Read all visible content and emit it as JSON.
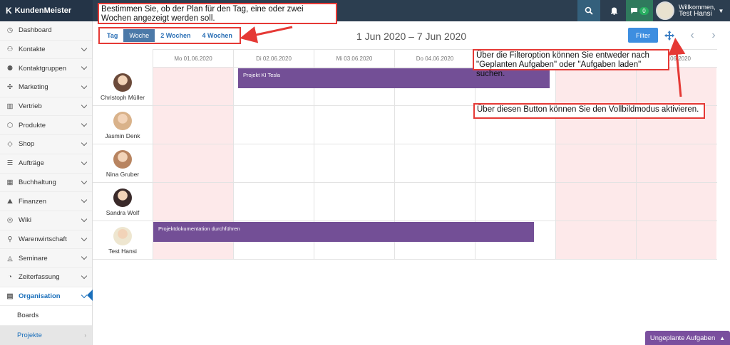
{
  "app": {
    "brand": "KundenMeister"
  },
  "topbar": {
    "chat_badge": "0",
    "welcome": "Willkommen,",
    "user_name": "Test Hansi"
  },
  "sidebar": {
    "items": [
      {
        "label": "Dashboard",
        "icon": "dashboard-icon"
      },
      {
        "label": "Kontakte",
        "icon": "contacts-icon"
      },
      {
        "label": "Kontaktgruppen",
        "icon": "groups-icon"
      },
      {
        "label": "Marketing",
        "icon": "marketing-icon"
      },
      {
        "label": "Vertrieb",
        "icon": "chart-icon"
      },
      {
        "label": "Produkte",
        "icon": "box-icon"
      },
      {
        "label": "Shop",
        "icon": "tag-icon"
      },
      {
        "label": "Aufträge",
        "icon": "orders-icon"
      },
      {
        "label": "Buchhaltung",
        "icon": "ledger-icon"
      },
      {
        "label": "Finanzen",
        "icon": "finance-icon"
      },
      {
        "label": "Wiki",
        "icon": "bulb-icon"
      },
      {
        "label": "Warenwirtschaft",
        "icon": "warehouse-icon"
      },
      {
        "label": "Seminare",
        "icon": "graduation-icon"
      },
      {
        "label": "Zeiterfassung",
        "icon": "clock-icon"
      },
      {
        "label": "Organisation",
        "icon": "clipboard-icon"
      }
    ],
    "subitems": [
      {
        "label": "Boards"
      },
      {
        "label": "Projekte"
      }
    ]
  },
  "toolbar": {
    "tabs": [
      "Tag",
      "Woche",
      "2 Wochen",
      "4 Wochen"
    ],
    "active_tab": "Woche",
    "range_title": "1 Jun 2020 – 7 Jun 2020",
    "filter_label": "Filter"
  },
  "grid": {
    "days": [
      "Mo 01.06.2020",
      "Di 02.06.2020",
      "Mi 03.06.2020",
      "Do 04.06.2020",
      "",
      "",
      "07.06.2020"
    ],
    "weekend_days": [
      0,
      5,
      6
    ],
    "people": [
      {
        "name": "Christoph Müller",
        "avatar_color": "#6b4a3a"
      },
      {
        "name": "Jasmin Denk",
        "avatar_color": "#d9b28a"
      },
      {
        "name": "Nina Gruber",
        "avatar_color": "#b88460"
      },
      {
        "name": "Sandra Wolf",
        "avatar_color": "#3a2a2a"
      },
      {
        "name": "Test Hansi",
        "avatar_color": "#eee6d0"
      }
    ],
    "events": [
      {
        "title": "Projekt KI Tesla",
        "row": 0,
        "color": "#734f96"
      },
      {
        "title": "Projektdokumentation durchführen",
        "row": 4,
        "color": "#734f96"
      }
    ]
  },
  "annotations": {
    "view_hint": "Bestimmen Sie, ob der Plan für den Tag, eine oder zwei Wochen angezeigt werden soll.",
    "filter_hint": "Über die Filteroption können Sie entweder nach \"Geplanten Aufgaben\" oder \"Aufgaben laden\" suchen.",
    "fullscreen_hint": "Über diesen Button können Sie den Vollbildmodus aktivieren."
  },
  "footer": {
    "unplanned_label": "Ungeplante Aufgaben"
  }
}
